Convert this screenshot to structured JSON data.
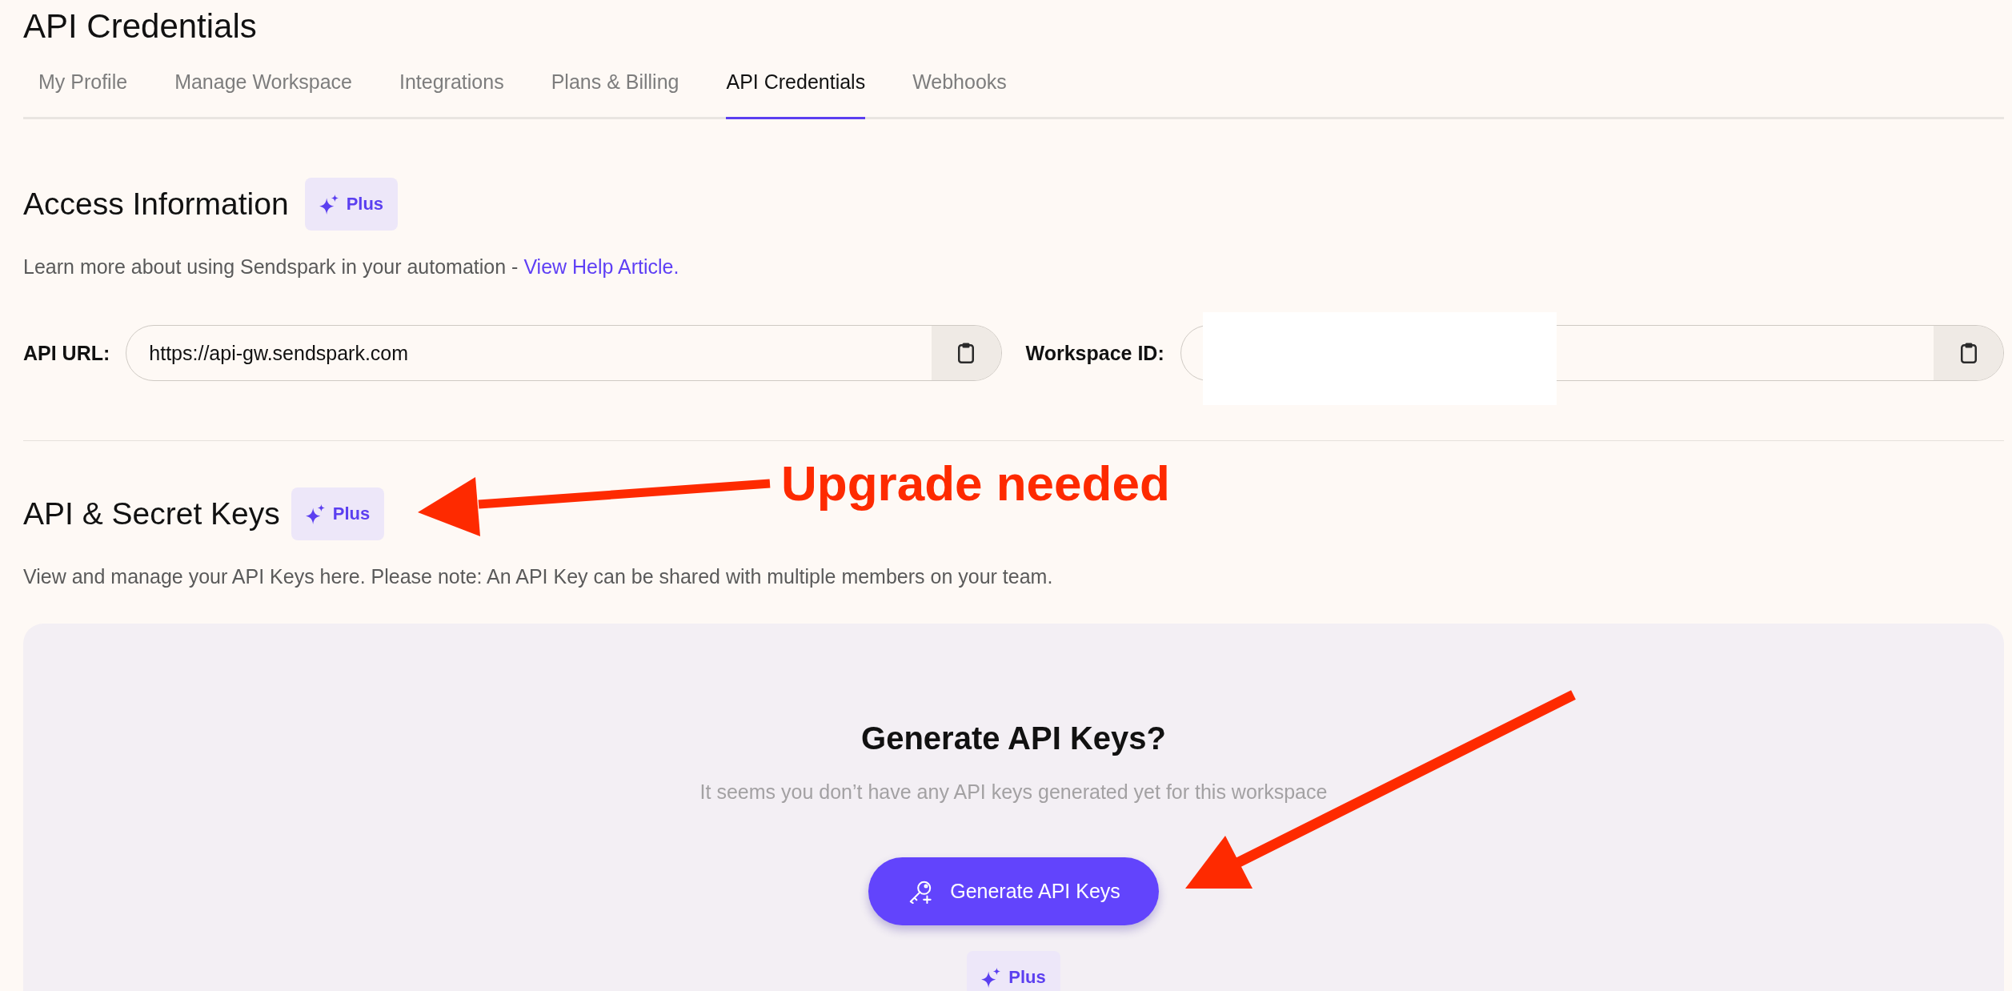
{
  "page": {
    "title": "API Credentials"
  },
  "tabs": [
    {
      "label": "My Profile",
      "selected": false
    },
    {
      "label": "Manage Workspace",
      "selected": false
    },
    {
      "label": "Integrations",
      "selected": false
    },
    {
      "label": "Plans & Billing",
      "selected": false
    },
    {
      "label": "API Credentials",
      "selected": true
    },
    {
      "label": "Webhooks",
      "selected": false
    }
  ],
  "access_information": {
    "heading": "Access Information",
    "badge": "Plus",
    "description": "Learn more about using Sendspark in your automation -",
    "link": "View Help Article.",
    "fields": [
      {
        "label": "API URL:",
        "value": "https://api-gw.sendspark.com",
        "redacted": false
      },
      {
        "label": "Workspace ID:",
        "redacted": true
      }
    ]
  },
  "api_keys": {
    "heading": "API & Secret Keys",
    "badge": "Plus",
    "description": "View and manage your API Keys here. Please note: An API Key can be shared with multiple members on your team.",
    "empty_state": {
      "title": "Generate API Keys?",
      "message": "It seems you don’t have any API keys generated yet for this workspace",
      "button": "Generate API Keys",
      "badge": "Plus"
    }
  },
  "annotation": {
    "label": "Upgrade needed"
  }
}
